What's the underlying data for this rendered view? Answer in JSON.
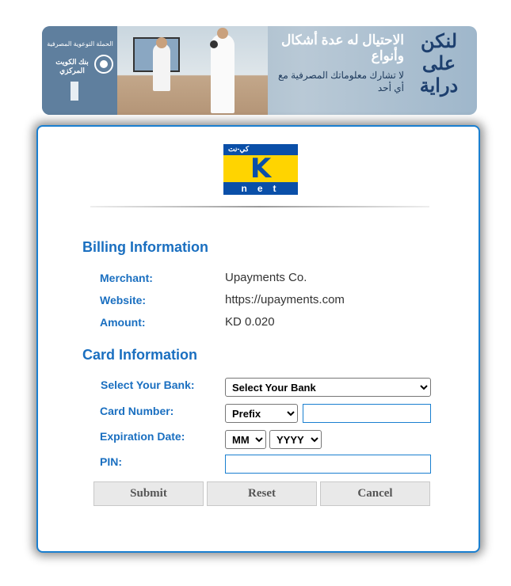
{
  "banner": {
    "campaign": "الحملة التوعوية المصرفية",
    "bank_name": "بنك الكويت المركزي",
    "headline": "الاحتيال له عدة أشكال وأنواع",
    "subline": "لا تشارك معلوماتك المصرفية مع أي أحد",
    "brand": "لنكن على دراية"
  },
  "logo": {
    "top_text": "كي-نت",
    "letter": "K",
    "bottom_text": "net"
  },
  "billing": {
    "title": "Billing Information",
    "merchant_label": "Merchant:",
    "merchant_value": "Upayments Co.",
    "website_label": "Website:",
    "website_value": "https://upayments.com",
    "amount_label": "Amount:",
    "amount_value": "KD 0.020"
  },
  "card": {
    "title": "Card Information",
    "bank_label": "Select Your Bank:",
    "bank_selected": "Select Your Bank",
    "card_number_label": "Card Number:",
    "prefix_selected": "Prefix",
    "expiry_label": "Expiration Date:",
    "month_selected": "MM",
    "year_selected": "YYYY",
    "pin_label": "PIN:"
  },
  "buttons": {
    "submit": "Submit",
    "reset": "Reset",
    "cancel": "Cancel"
  }
}
